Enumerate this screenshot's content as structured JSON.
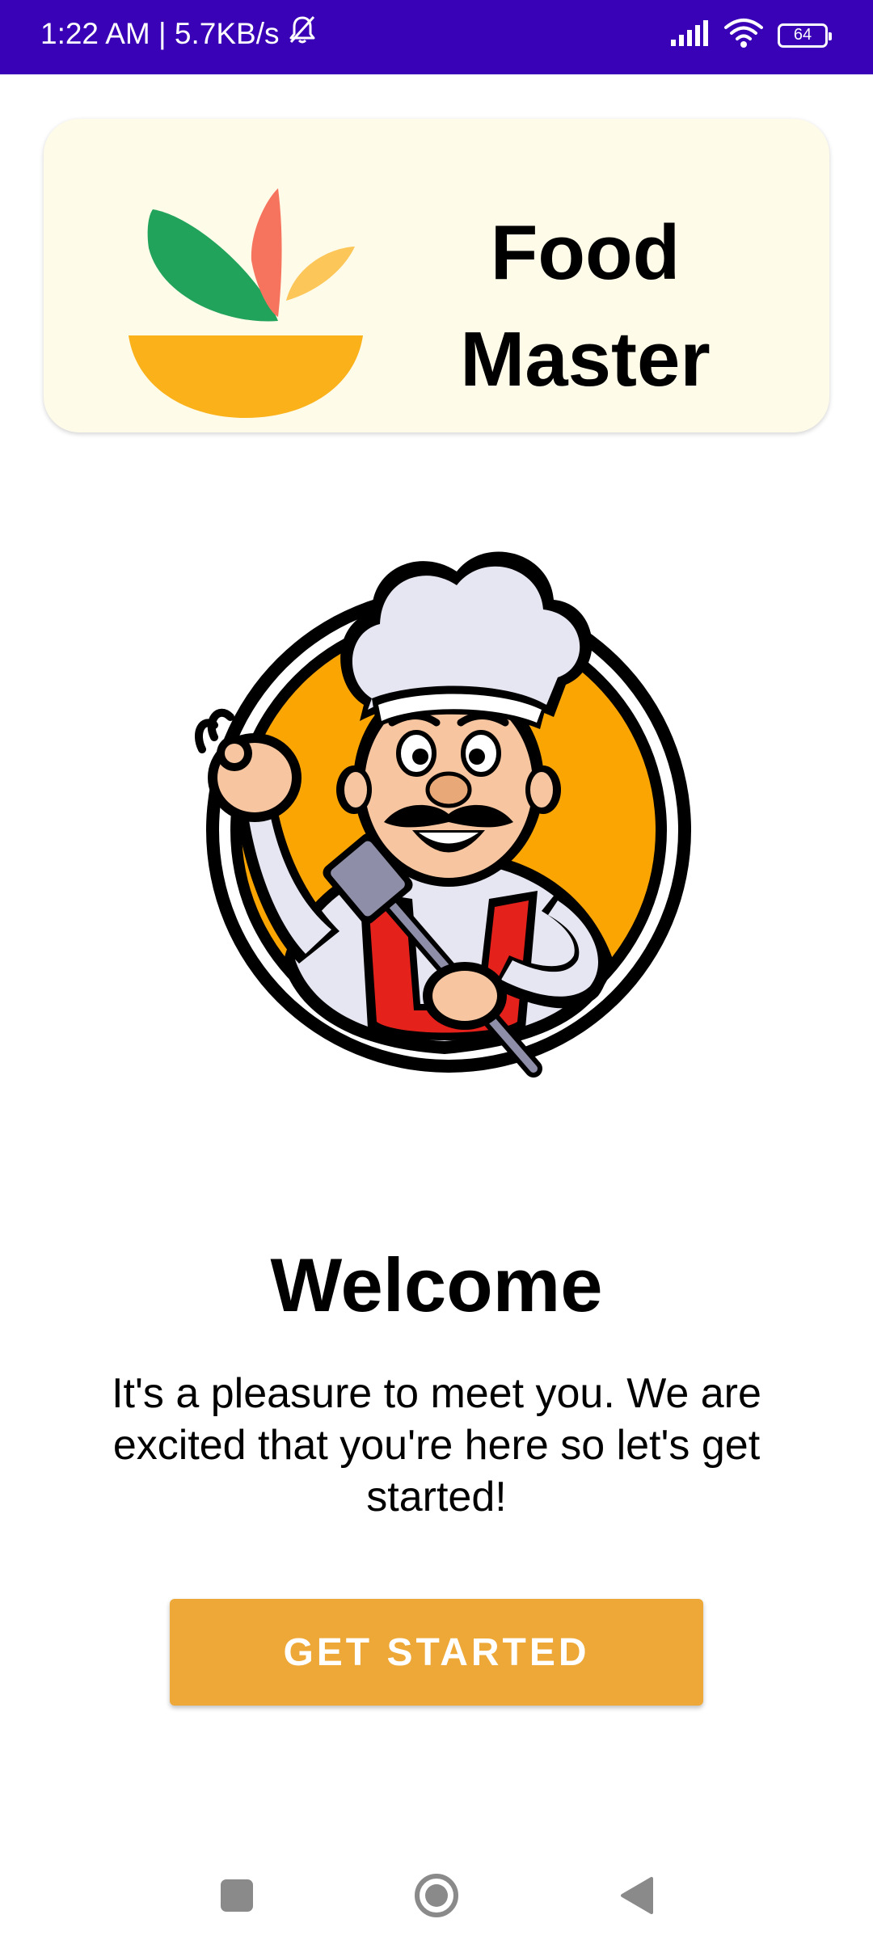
{
  "status_bar": {
    "time_speed": "1:22 AM | 5.7KB/s",
    "battery_level": "64",
    "background_color": "#3a02b6",
    "icons": [
      "bell-off-icon",
      "signal-icon",
      "wifi-icon",
      "battery-icon"
    ]
  },
  "header": {
    "title_line1": "Food",
    "title_line2": "Master",
    "card_color": "#fffbe9"
  },
  "hero": {
    "image": "chef-mascot-illustration"
  },
  "welcome": {
    "title": "Welcome",
    "message": "It's a pleasure to meet you. We are excited that you're here so let's get started!"
  },
  "cta": {
    "label": "GET STARTED",
    "color": "#eda838"
  },
  "nav_bar": {
    "icons": [
      "recents-icon",
      "home-icon",
      "back-icon"
    ]
  }
}
